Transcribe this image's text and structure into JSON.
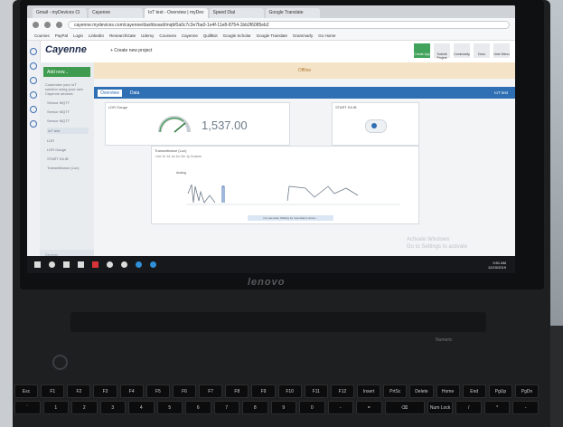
{
  "browser": {
    "tabs": [
      {
        "label": "Gmail - myDevices Cl"
      },
      {
        "label": "Cayenne"
      },
      {
        "label": "IoT test - Overview | myDev"
      },
      {
        "label": "Speed Dial"
      },
      {
        "label": "Google Translate"
      }
    ],
    "url": "cayenne.mydevices.com/cayenne/dashboard/mqtt/0a0c7c3e7ba0-1e4f-11e8-8754-1bb2f6085eb2",
    "bookmarks": [
      "Courses",
      "PayPal",
      "Login",
      "LinkedIn",
      "ResearchGate",
      "Udemy",
      "Coursera",
      "Cayenne",
      "QuillBot",
      "Google Scholar",
      "Google Translate",
      "Grammarly",
      "Go Home"
    ]
  },
  "app": {
    "logo": "Cayenne",
    "create_project": "+ Create new project",
    "header_actions": [
      "Create App",
      "Submit Project",
      "Community",
      "Docs",
      "User Menu"
    ],
    "sidebar": {
      "add_new": "Add new...",
      "description": "Customize your IoT solution using your own Cayenne devices",
      "items": [
        "Sensor MQTT",
        "Sensor MQTT",
        "Sensor MQTT",
        "IoT test",
        "LDR",
        "LDR Gauge",
        "START KILIB",
        "Transmittance (Lux)"
      ],
      "footer": "Devices"
    },
    "offline_text": "Offline",
    "tabs": {
      "overview": "Overview",
      "data": "Data",
      "right": "IoT test"
    },
    "widgets": {
      "gauge": {
        "title": "LDR Gauge",
        "value": "1,537.00"
      },
      "button": {
        "title": "START KILIB"
      },
      "chart": {
        "title": "Transmittance (Lux)",
        "toolbar": "Live 1h 1d 1w 1m 3m 1y Custom",
        "legend": "Analog",
        "ylabel": "Analog",
        "caption": "No new data. Waiting for new data to arrive..."
      }
    },
    "watermark": [
      "Activate Windows",
      "Go to Settings to activate"
    ]
  },
  "taskbar": {
    "time": "9:51 AM",
    "date": "12/15/2019"
  },
  "laptop": {
    "brand": "lenovo",
    "keyboard_label": "Numeric"
  },
  "keyboard": {
    "row1": [
      "Esc",
      "F1",
      "F2",
      "F3",
      "F4",
      "F5",
      "F6",
      "F7",
      "F8",
      "F9",
      "F10",
      "F11",
      "F12",
      "Insert",
      "PrtSc",
      "Delete",
      "Home",
      "End",
      "PgUp",
      "PgDn"
    ],
    "row2": [
      "`",
      "1",
      "2",
      "3",
      "4",
      "5",
      "6",
      "7",
      "8",
      "9",
      "0",
      "-",
      "=",
      "⌫",
      "Num Lock",
      "/",
      "*",
      "-"
    ]
  }
}
